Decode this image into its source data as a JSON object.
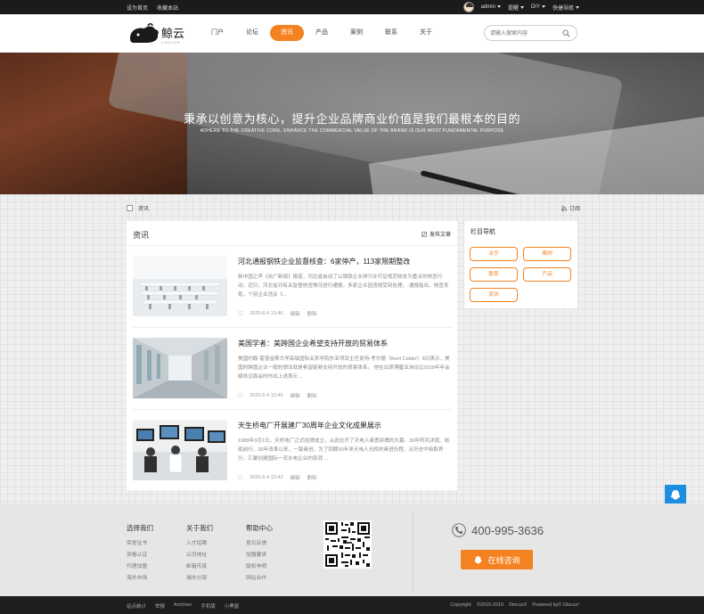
{
  "topbar": {
    "links": [
      "设为首页",
      "收藏本站"
    ],
    "user": "admin",
    "menus": [
      "提醒",
      "DIY",
      "快捷导航"
    ]
  },
  "header": {
    "logo_text": "鲸云",
    "logo_sub": "JINGYUN",
    "nav": [
      "门户",
      "论坛",
      "资讯",
      "产品",
      "案例",
      "联系",
      "关于"
    ],
    "active_index": 2,
    "search_placeholder": "请输入搜索内容"
  },
  "banner": {
    "title_cn": "秉承以创意为核心，提升企业品牌商业价值是我们最根本的目的",
    "title_en": "ADHERE TO THE CREATIVE CORE, ENHANCE THE COMMERCIAL VALUE OF THE BRAND IS OUR MOST FUNDAMENTAL PURPOSE"
  },
  "breadcrumb": {
    "current": "资讯",
    "rss": "订阅"
  },
  "list": {
    "title": "资讯",
    "post_label": "发布文章",
    "articles": [
      {
        "title": "河北通报钢铁企业监督核查：6家停产，113家限期整改",
        "desc": "新中国之声《央广新闻》报道，河北省启动了以钢铁企业排污许可证规范核发为重点的核查行动。近日，河北省对有关监督核查情况进行通报，多家企业因违规受到处理。        通报指出，核查发现，个别企业违反《...",
        "date": "2020-6-4 13:46",
        "edit": "编辑",
        "delete": "删除"
      },
      {
        "title": "美国学者：美跨国企业希望支持开放的贸易体系",
        "desc": "美国约翰·霍普金斯大学高级国际关系学院东亚项目主任肯特·考尔德（Kent Calder）8日表示，美国的跨国企业一般的想法就是希望能够支持开放的贸易体系。        他在出席博鳌亚洲论坛2018年年会媒体见面会时作出上述表示 ...",
        "date": "2020-6-4 13:45",
        "edit": "编辑",
        "delete": "删除"
      },
      {
        "title": "天生桥电厂开展建厂30周年企业文化成果展示",
        "desc": "1988年3月1日，天桥电厂正式挂牌成立，从此拉开了天电人奋勇拼搏的大幕。30年栉风沐雨、砥砺前行，30年改革以来，一路奋进。为了回顾30年来天电人光辉的奋进历程，从历史中吸取养分，汇聚创建国际一流水电企业的澎湃 ...",
        "date": "2020-6-4 13:42",
        "edit": "编辑",
        "delete": "删除"
      }
    ]
  },
  "sidebar": {
    "title": "栏目导航",
    "tags": [
      "关于",
      "案例",
      "联系",
      "产品",
      "资讯"
    ]
  },
  "footer": {
    "cols": [
      {
        "title": "选择我们",
        "items": [
          "荣誉证书",
          "资格认证",
          "代理加盟",
          "海外市场"
        ]
      },
      {
        "title": "关于我们",
        "items": [
          "人才招聘",
          "公司地址",
          "邮箱传真",
          "城市分部"
        ]
      },
      {
        "title": "帮助中心",
        "items": [
          "意见反馈",
          "加盟要求",
          "版权申明",
          "网站合作"
        ]
      }
    ],
    "phone": "400-995-3636",
    "online": "在线咨询"
  },
  "bottombar": {
    "links": [
      "站点统计",
      "举报",
      "Archiver",
      "手机版",
      "小黑屋"
    ],
    "copyright": "Copyright",
    "years": "©2015-2016",
    "brand": "DiscuzX",
    "powered": "Powered by© Discuz!"
  },
  "colors": {
    "accent": "#f58220",
    "float": "#1e8fe0"
  }
}
